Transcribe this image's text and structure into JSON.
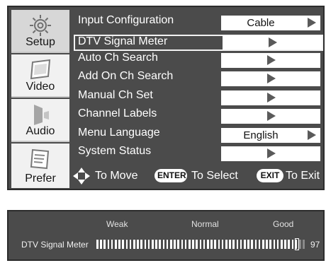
{
  "sidebar": {
    "tabs": [
      {
        "label": "Setup",
        "icon": "gear-icon",
        "active": true
      },
      {
        "label": "Video",
        "icon": "video-icon",
        "active": false
      },
      {
        "label": "Audio",
        "icon": "speaker-icon",
        "active": false
      },
      {
        "label": "Prefer",
        "icon": "preferences-icon",
        "active": false
      }
    ]
  },
  "menu": {
    "items": [
      {
        "label": "Input Configuration",
        "value": "Cable"
      },
      {
        "label": "DTV Signal Meter",
        "value": ""
      },
      {
        "label": "Auto Ch Search",
        "value": ""
      },
      {
        "label": "Add On Ch Search",
        "value": ""
      },
      {
        "label": "Manual Ch Set",
        "value": ""
      },
      {
        "label": "Channel Labels",
        "value": ""
      },
      {
        "label": "Menu Language",
        "value": "English"
      },
      {
        "label": "System Status",
        "value": ""
      }
    ],
    "selected_index": 1
  },
  "nav": {
    "move_text": "To Move",
    "enter_key": "ENTER",
    "select_text": "To Select",
    "exit_key": "EXIT",
    "exit_text": "To Exit"
  },
  "signal_meter": {
    "label": "DTV Signal Meter",
    "levels": [
      "Weak",
      "Normal",
      "Good"
    ],
    "value": "97",
    "level_fraction": 0.97
  },
  "colors": {
    "panel": "#4b4b4b",
    "sidebar_tab": "#f1f1f1",
    "value_box": "#ffffff",
    "text": "#ffffff"
  }
}
